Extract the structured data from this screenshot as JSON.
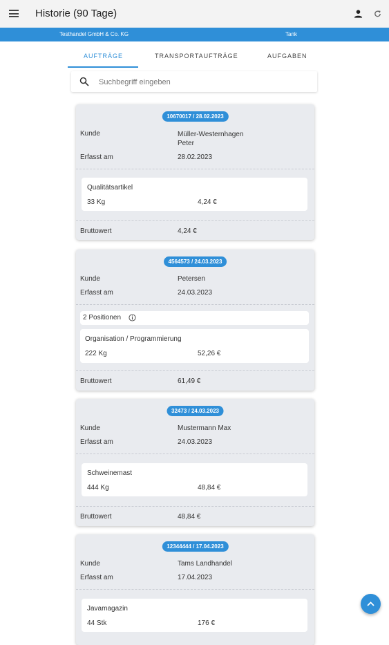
{
  "appbar": {
    "title": "Historie (90 Tage)"
  },
  "context": {
    "company": "Testhandel GmbH & Co. KG",
    "site": "Tank"
  },
  "tabs": [
    {
      "label": "AUFTRÄGE",
      "active": true
    },
    {
      "label": "TRANSPORTAUFTRÄGE",
      "active": false
    },
    {
      "label": "AUFGABEN",
      "active": false
    }
  ],
  "search": {
    "placeholder": "Suchbegriff eingeben"
  },
  "orders": [
    {
      "id": "10670017 / 28.02.2023",
      "customer_label": "Kunde",
      "customer": "Müller-Westernhagen Peter",
      "date_label": "Erfasst am",
      "date": "28.02.2023",
      "items": [
        {
          "name": "Qualitätsartikel",
          "qty": "33 Kg",
          "price": "4,24 €"
        }
      ],
      "total_label": "Bruttowert",
      "total": "4,24 €"
    },
    {
      "id": "4564573 / 24.03.2023",
      "customer_label": "Kunde",
      "customer": "Petersen",
      "date_label": "Erfasst am",
      "date": "24.03.2023",
      "positions_label": "2 Positionen",
      "items": [
        {
          "name": "Organisation / Programmierung",
          "qty": "222 Kg",
          "price": "52,26 €"
        }
      ],
      "total_label": "Bruttowert",
      "total": "61,49 €"
    },
    {
      "id": "32473 / 24.03.2023",
      "customer_label": "Kunde",
      "customer": "Mustermann Max",
      "date_label": "Erfasst am",
      "date": "24.03.2023",
      "items": [
        {
          "name": "Schweinemast",
          "qty": "444 Kg",
          "price": "48,84 €"
        }
      ],
      "total_label": "Bruttowert",
      "total": "48,84 €"
    },
    {
      "id": "12344444 / 17.04.2023",
      "customer_label": "Kunde",
      "customer": "Tams Landhandel",
      "date_label": "Erfasst am",
      "date": "17.04.2023",
      "items": [
        {
          "name": "Javamagazin",
          "qty": "44 Stk",
          "price": "176 €"
        }
      ]
    }
  ],
  "colors": {
    "accent": "#2f8fd8",
    "appbar": "#f3f3f3",
    "card": "#e9ebef"
  },
  "icons": {
    "menu": "menu-icon",
    "account": "person-icon",
    "refresh": "refresh-icon",
    "search": "search-icon",
    "info": "info-icon",
    "scroll_top": "arrow-up-icon"
  }
}
